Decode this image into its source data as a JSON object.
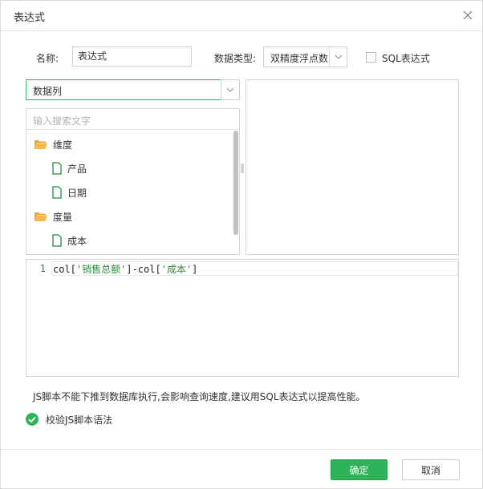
{
  "dialog": {
    "title": "表达式"
  },
  "form": {
    "name_label": "名称:",
    "name_value": "表达式",
    "datatype_label": "数据类型:",
    "datatype_value": "双精度浮点数",
    "sql_label": "SQL表达式",
    "sql_checked": false
  },
  "column_selector": {
    "value": "数据列"
  },
  "search": {
    "placeholder": "输入搜索文字"
  },
  "tree": {
    "groups": [
      {
        "label": "维度",
        "items": [
          "产品",
          "日期"
        ]
      },
      {
        "label": "度量",
        "items": [
          "成本"
        ]
      }
    ]
  },
  "editor": {
    "line_number": "1",
    "code_parts": [
      "col[",
      "'销售总额'",
      "]-col[",
      "'成本'",
      "]"
    ]
  },
  "notice": "JS脚本不能下推到数据库执行,会影响查询速度,建议用SQL表达式以提高性能。",
  "verify": {
    "label": "校验JS脚本语法",
    "status": "valid"
  },
  "footer": {
    "ok_label": "确定",
    "cancel_label": "取消"
  },
  "colors": {
    "accent": "#2fb35a",
    "folder": "#f5a623",
    "field_icon": "#3aa15a",
    "selector_border": "#3cb371"
  },
  "icons": {
    "close": "close-icon",
    "dropdown": "chevron-down-icon",
    "folder": "folder-open-icon",
    "field": "document-icon",
    "verify": "check-circle-icon"
  }
}
